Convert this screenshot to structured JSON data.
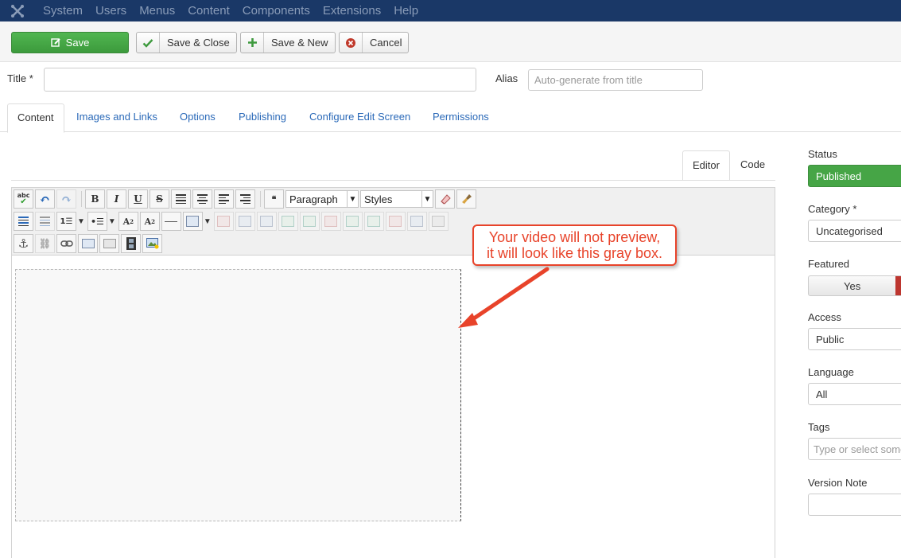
{
  "menubar": {
    "logo_icon": "joomla-logo-icon",
    "items": [
      "System",
      "Users",
      "Menus",
      "Content",
      "Components",
      "Extensions",
      "Help"
    ]
  },
  "toolbar": {
    "save_label": "Save",
    "save_close_label": "Save & Close",
    "save_new_label": "Save & New",
    "cancel_label": "Cancel"
  },
  "form": {
    "title_label": "Title *",
    "title_value": "",
    "alias_label": "Alias",
    "alias_placeholder": "Auto-generate from title"
  },
  "tabs": [
    "Content",
    "Images and Links",
    "Options",
    "Publishing",
    "Configure Edit Screen",
    "Permissions"
  ],
  "editor": {
    "toggle_editor": "Editor",
    "toggle_code": "Code",
    "format_select": "Paragraph",
    "styles_select": "Styles"
  },
  "callout": {
    "line1": "Your video will not preview,",
    "line2": "it will look like this gray box."
  },
  "sidebar": {
    "status_label": "Status",
    "status_value": "Published",
    "category_label": "Category *",
    "category_value": "Uncategorised",
    "featured_label": "Featured",
    "featured_yes": "Yes",
    "access_label": "Access",
    "access_value": "Public",
    "language_label": "Language",
    "language_value": "All",
    "tags_label": "Tags",
    "tags_placeholder": "Type or select some options",
    "version_note_label": "Version Note",
    "version_note_value": ""
  },
  "colors": {
    "menubar_bg": "#1a3867",
    "save_green": "#46a546",
    "link_blue": "#2a69b8",
    "callout_red": "#e8432a",
    "featured_no_red": "#bd362f"
  }
}
